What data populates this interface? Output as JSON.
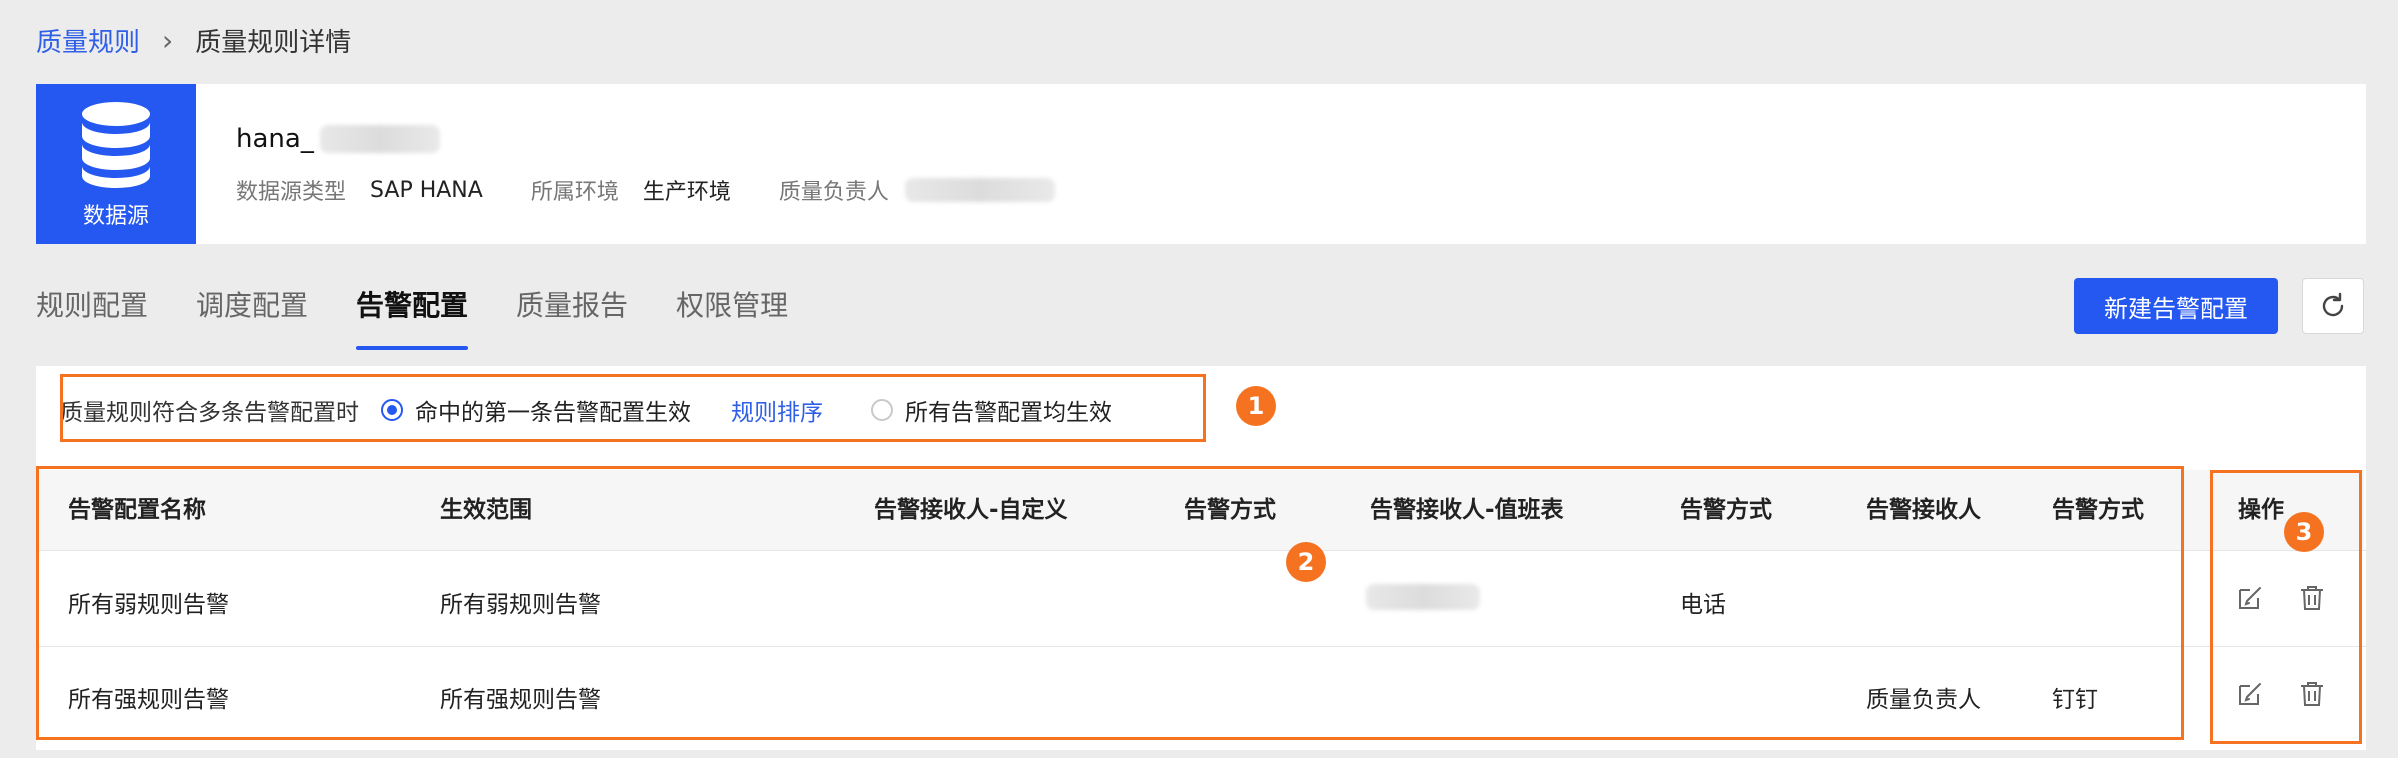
{
  "breadcrumb": {
    "parent": "质量规则",
    "separator": "›",
    "current": "质量规则详情"
  },
  "datasource": {
    "tile_label": "数据源",
    "name": "hana_",
    "type_label": "数据源类型",
    "type_value": "SAP HANA",
    "env_label": "所属环境",
    "env_value": "生产环境",
    "owner_label": "质量负责人"
  },
  "tabs": [
    {
      "label": "规则配置"
    },
    {
      "label": "调度配置"
    },
    {
      "label": "告警配置",
      "active": true
    },
    {
      "label": "质量报告"
    },
    {
      "label": "权限管理"
    }
  ],
  "actions": {
    "new_alert": "新建告警配置"
  },
  "radio_bar": {
    "label": "质量规则符合多条告警配置时",
    "option1": "命中的第一条告警配置生效",
    "sort_link": "规则排序",
    "option2": "所有告警配置均生效"
  },
  "table": {
    "headers": [
      "告警配置名称",
      "生效范围",
      "告警接收人-自定义",
      "告警方式",
      "告警接收人-值班表",
      "告警方式",
      "告警接收人",
      "告警方式"
    ],
    "ops_header": "操作",
    "rows": [
      [
        "所有弱规则告警",
        "所有弱规则告警",
        "",
        "",
        "",
        "电话",
        "",
        ""
      ],
      [
        "所有强规则告警",
        "所有强规则告警",
        "",
        "",
        "",
        "",
        "质量负责人",
        "钉钉"
      ]
    ]
  },
  "annotations": {
    "badge1": "1",
    "badge2": "2",
    "badge3": "3"
  },
  "colors": {
    "primary": "#2558f0",
    "annotation": "#f57320",
    "link": "#2f5fe6"
  },
  "icons": {
    "datasource": "database-icon",
    "refresh": "refresh-icon",
    "edit": "edit-icon",
    "delete": "trash-icon"
  }
}
